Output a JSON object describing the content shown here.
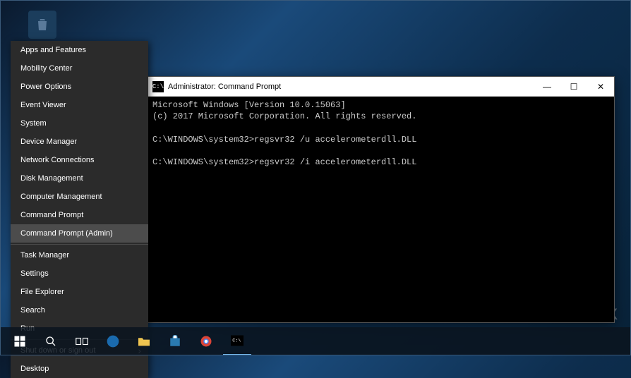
{
  "desktop": {
    "icon_label": "Recycle Bin"
  },
  "winx_menu": {
    "groups": [
      {
        "items": [
          {
            "label": "Apps and Features"
          },
          {
            "label": "Mobility Center"
          },
          {
            "label": "Power Options"
          },
          {
            "label": "Event Viewer"
          },
          {
            "label": "System"
          },
          {
            "label": "Device Manager"
          },
          {
            "label": "Network Connections"
          },
          {
            "label": "Disk Management"
          },
          {
            "label": "Computer Management"
          },
          {
            "label": "Command Prompt"
          },
          {
            "label": "Command Prompt (Admin)",
            "selected": true
          }
        ]
      },
      {
        "items": [
          {
            "label": "Task Manager"
          },
          {
            "label": "Settings"
          },
          {
            "label": "File Explorer"
          },
          {
            "label": "Search"
          },
          {
            "label": "Run"
          }
        ]
      },
      {
        "items": [
          {
            "label": "Shut down or sign out",
            "submenu": true
          },
          {
            "label": "Desktop"
          }
        ]
      }
    ]
  },
  "cmd": {
    "title": "Administrator: Command Prompt",
    "icon_text": "C:\\",
    "lines": [
      "Microsoft Windows [Version 10.0.15063]",
      "(c) 2017 Microsoft Corporation. All rights reserved.",
      "",
      "C:\\WINDOWS\\system32>regsvr32 /u accelerometerdll.DLL",
      "",
      "C:\\WINDOWS\\system32>regsvr32 /i accelerometerdll.DLL"
    ]
  },
  "window_controls": {
    "minimize": "—",
    "maximize": "☐",
    "close": "✕"
  },
  "watermark": "UG⟲TFIX"
}
